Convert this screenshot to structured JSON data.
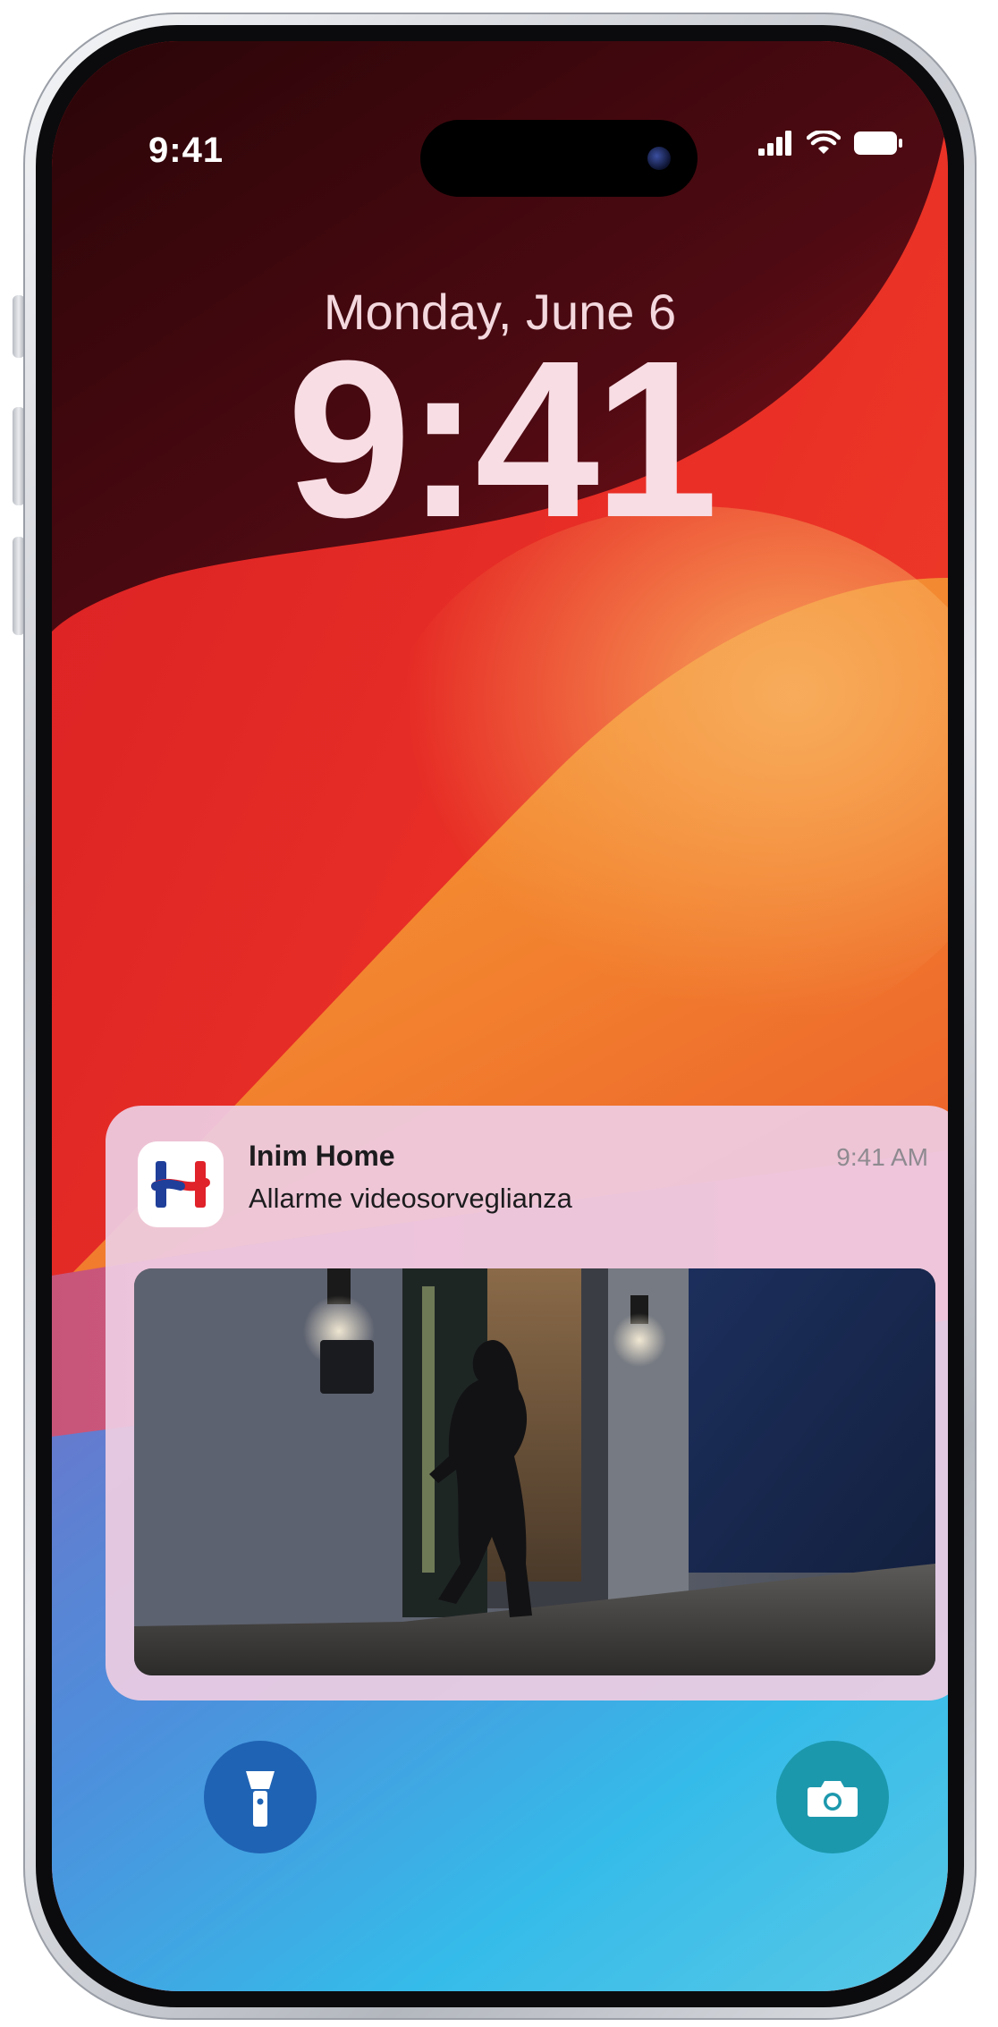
{
  "status_bar": {
    "time": "9:41",
    "icons": [
      "cellular-signal-icon",
      "wifi-icon",
      "battery-icon"
    ]
  },
  "lock_screen": {
    "date": "Monday, June 6",
    "time": "9:41"
  },
  "notification": {
    "app_name": "Inim Home",
    "time": "9:41 AM",
    "message": "Allarme videosorveglianza",
    "app_icon": "inim-home-logo-icon",
    "attachment": "surveillance camera snapshot"
  },
  "quick_actions": {
    "left": "flashlight-icon",
    "right": "camera-icon"
  },
  "colors": {
    "wallpaper_dark": "#5a0a14",
    "wallpaper_red": "#e42a28",
    "wallpaper_orange": "#f3902f",
    "wallpaper_blue": "#3bb5e6",
    "notification_bg": "#eeccE2",
    "flashlight_button": "#1f63b4",
    "camera_button": "#1c98ad",
    "logo_red": "#e0222a",
    "logo_blue": "#1f3f9a"
  }
}
